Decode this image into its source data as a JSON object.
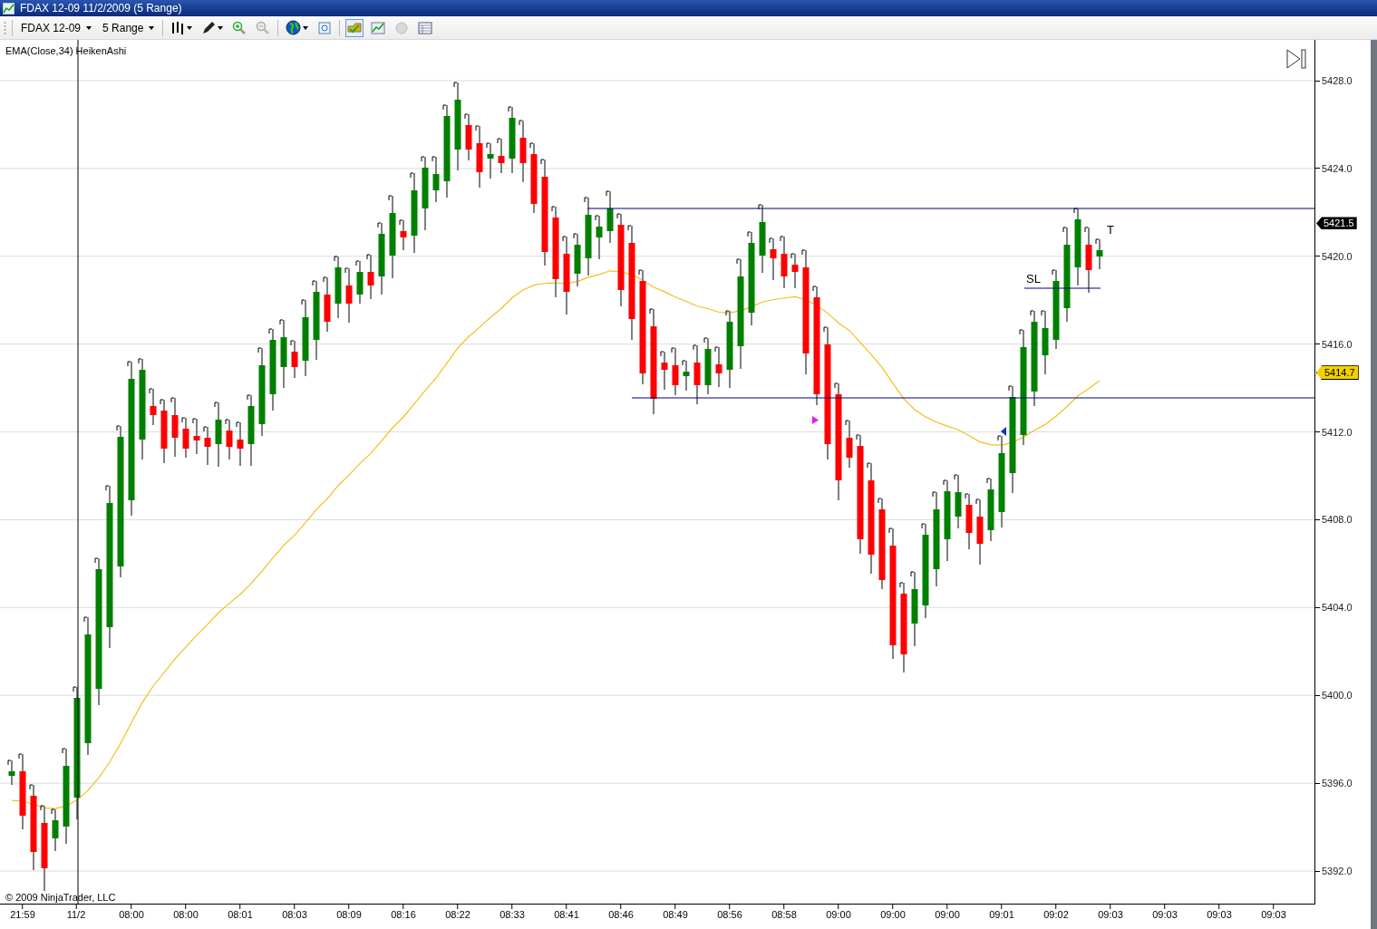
{
  "window": {
    "title": "FDAX 12-09  11/2/2009 (5 Range)"
  },
  "toolbar": {
    "instrument": "FDAX 12-09",
    "period": "5 Range"
  },
  "chart": {
    "indicators": [
      "EMA(Close,34)",
      "HeikenAshi"
    ],
    "price_ticks": [
      "5428.0",
      "5424.0",
      "5420.0",
      "5416.0",
      "5412.0",
      "5408.0",
      "5404.0",
      "5400.0",
      "5396.0",
      "5392.0"
    ],
    "price_markers": [
      {
        "text": "5421.5",
        "kind": "last"
      },
      {
        "text": "5414.7",
        "kind": "ema"
      }
    ],
    "annotations": [
      {
        "text": "SL",
        "kind": "stop"
      },
      {
        "text": "T",
        "kind": "target"
      }
    ],
    "time_ticks": [
      "21:59",
      "11/2",
      "08:00",
      "08:00",
      "08:01",
      "08:03",
      "08:09",
      "08:16",
      "08:22",
      "08:33",
      "08:41",
      "08:46",
      "08:49",
      "08:56",
      "08:58",
      "09:00",
      "09:00",
      "09:00",
      "09:01",
      "09:02",
      "09:03",
      "09:03",
      "09:03",
      "09:03"
    ],
    "copyright": "© 2009 NinjaTrader, LLC"
  }
}
